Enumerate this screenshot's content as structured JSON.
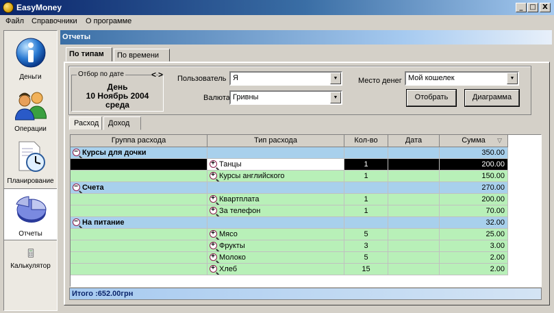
{
  "window": {
    "title": "EasyMoney",
    "buttons": {
      "minimize": "_",
      "maximize": "□",
      "close": "X"
    }
  },
  "menu": {
    "items": [
      "Файл",
      "Справочники",
      "О программе"
    ]
  },
  "sidebar": {
    "items": [
      {
        "label": "Деньги",
        "icon": "info-icon"
      },
      {
        "label": "Операции",
        "icon": "users-icon"
      },
      {
        "label": "Планирование",
        "icon": "clock-document-icon"
      },
      {
        "label": "Отчеты",
        "icon": "pie-chart-icon"
      },
      {
        "label": "Калькулятор",
        "icon": "calculator-icon"
      }
    ],
    "active": "Отчеты"
  },
  "panel": {
    "title": "Отчеты"
  },
  "tabs": [
    "По типам",
    "По времени"
  ],
  "date_filter": {
    "legend": "Отбор по дате",
    "nav_prev": "<",
    "nav_next": ">",
    "period": "День",
    "date": "10 Ноябрь 2004",
    "weekday": "среда"
  },
  "filters": {
    "user_label": "Пользователь",
    "user_value": "Я",
    "currency_label": "Валюта",
    "currency_value": "Гривны",
    "place_label": "Место денег",
    "place_value": "Мой кошелек"
  },
  "buttons": {
    "select": "Отобрать",
    "chart": "Диаграмма"
  },
  "subtabs": [
    "Расход",
    "Доход"
  ],
  "grid": {
    "columns": [
      "Группа расхода",
      "Тип расхода",
      "Кол-во",
      "Дата",
      "Сумма"
    ],
    "sort_indicator": "▽",
    "groups": [
      {
        "name": "Курсы для дочки",
        "sum": "350.00",
        "items": [
          {
            "type": "Танцы",
            "qty": "1",
            "date": "",
            "sum": "200.00",
            "selected": true
          },
          {
            "type": "Курсы английского",
            "qty": "1",
            "date": "",
            "sum": "150.00"
          }
        ]
      },
      {
        "name": "Счета",
        "sum": "270.00",
        "items": [
          {
            "type": "Квартплата",
            "qty": "1",
            "date": "",
            "sum": "200.00"
          },
          {
            "type": "За телефон",
            "qty": "1",
            "date": "",
            "sum": "70.00"
          }
        ]
      },
      {
        "name": "На питание",
        "sum": "32.00",
        "items": [
          {
            "type": "Мясо",
            "qty": "5",
            "date": "",
            "sum": "25.00"
          },
          {
            "type": "Фрукты",
            "qty": "3",
            "date": "",
            "sum": "3.00"
          },
          {
            "type": "Молоко",
            "qty": "5",
            "date": "",
            "sum": "2.00"
          },
          {
            "type": "Хлеб",
            "qty": "15",
            "date": "",
            "sum": "2.00"
          }
        ]
      }
    ]
  },
  "total": "Итого :652.00грн",
  "colors": {
    "group_row": "#a8d0ec",
    "item_row": "#b8f0b8",
    "title_bar": "#0a246a"
  }
}
